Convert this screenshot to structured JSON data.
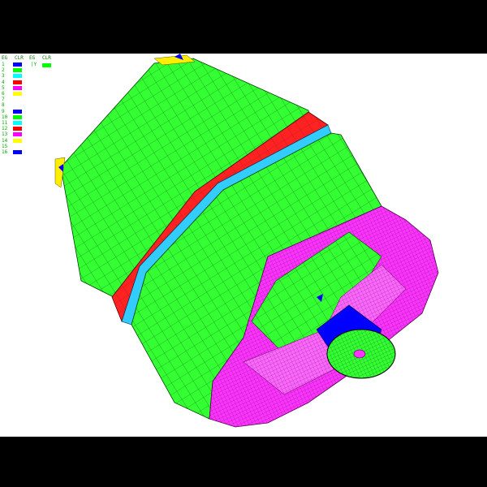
{
  "legend": {
    "col1_header_eg": "EG",
    "col1_header_clr": "CLR",
    "col2_header_eg": "EG",
    "col2_header_clr": "CLR",
    "col2_value": "|Y",
    "col2_color": "#00ff00",
    "rows": [
      {
        "num": "1",
        "color": "#0000ff"
      },
      {
        "num": "2",
        "color": "#00ff00"
      },
      {
        "num": "3",
        "color": "#00ffff"
      },
      {
        "num": "4",
        "color": "#ff0000"
      },
      {
        "num": "5",
        "color": "#ff00ff"
      },
      {
        "num": "6",
        "color": "#ffff00"
      },
      {
        "num": "7",
        "color": ""
      },
      {
        "num": "8",
        "color": ""
      },
      {
        "num": "9",
        "color": "#0000ff"
      },
      {
        "num": "10",
        "color": "#00ff00"
      },
      {
        "num": "11",
        "color": "#00ffff"
      },
      {
        "num": "12",
        "color": "#ff0000"
      },
      {
        "num": "13",
        "color": "#ff00ff"
      },
      {
        "num": "14",
        "color": "#ffff00"
      },
      {
        "num": "15",
        "color": ""
      },
      {
        "num": "16",
        "color": "#0000ff"
      }
    ]
  },
  "colors": {
    "shell": "#33ff33",
    "ring": "#ff2222",
    "ring_inner": "#33ccff",
    "rear": "#ff33ff",
    "hub": "#0000ff",
    "edge": "#ffee00",
    "mesh": "#000000"
  }
}
